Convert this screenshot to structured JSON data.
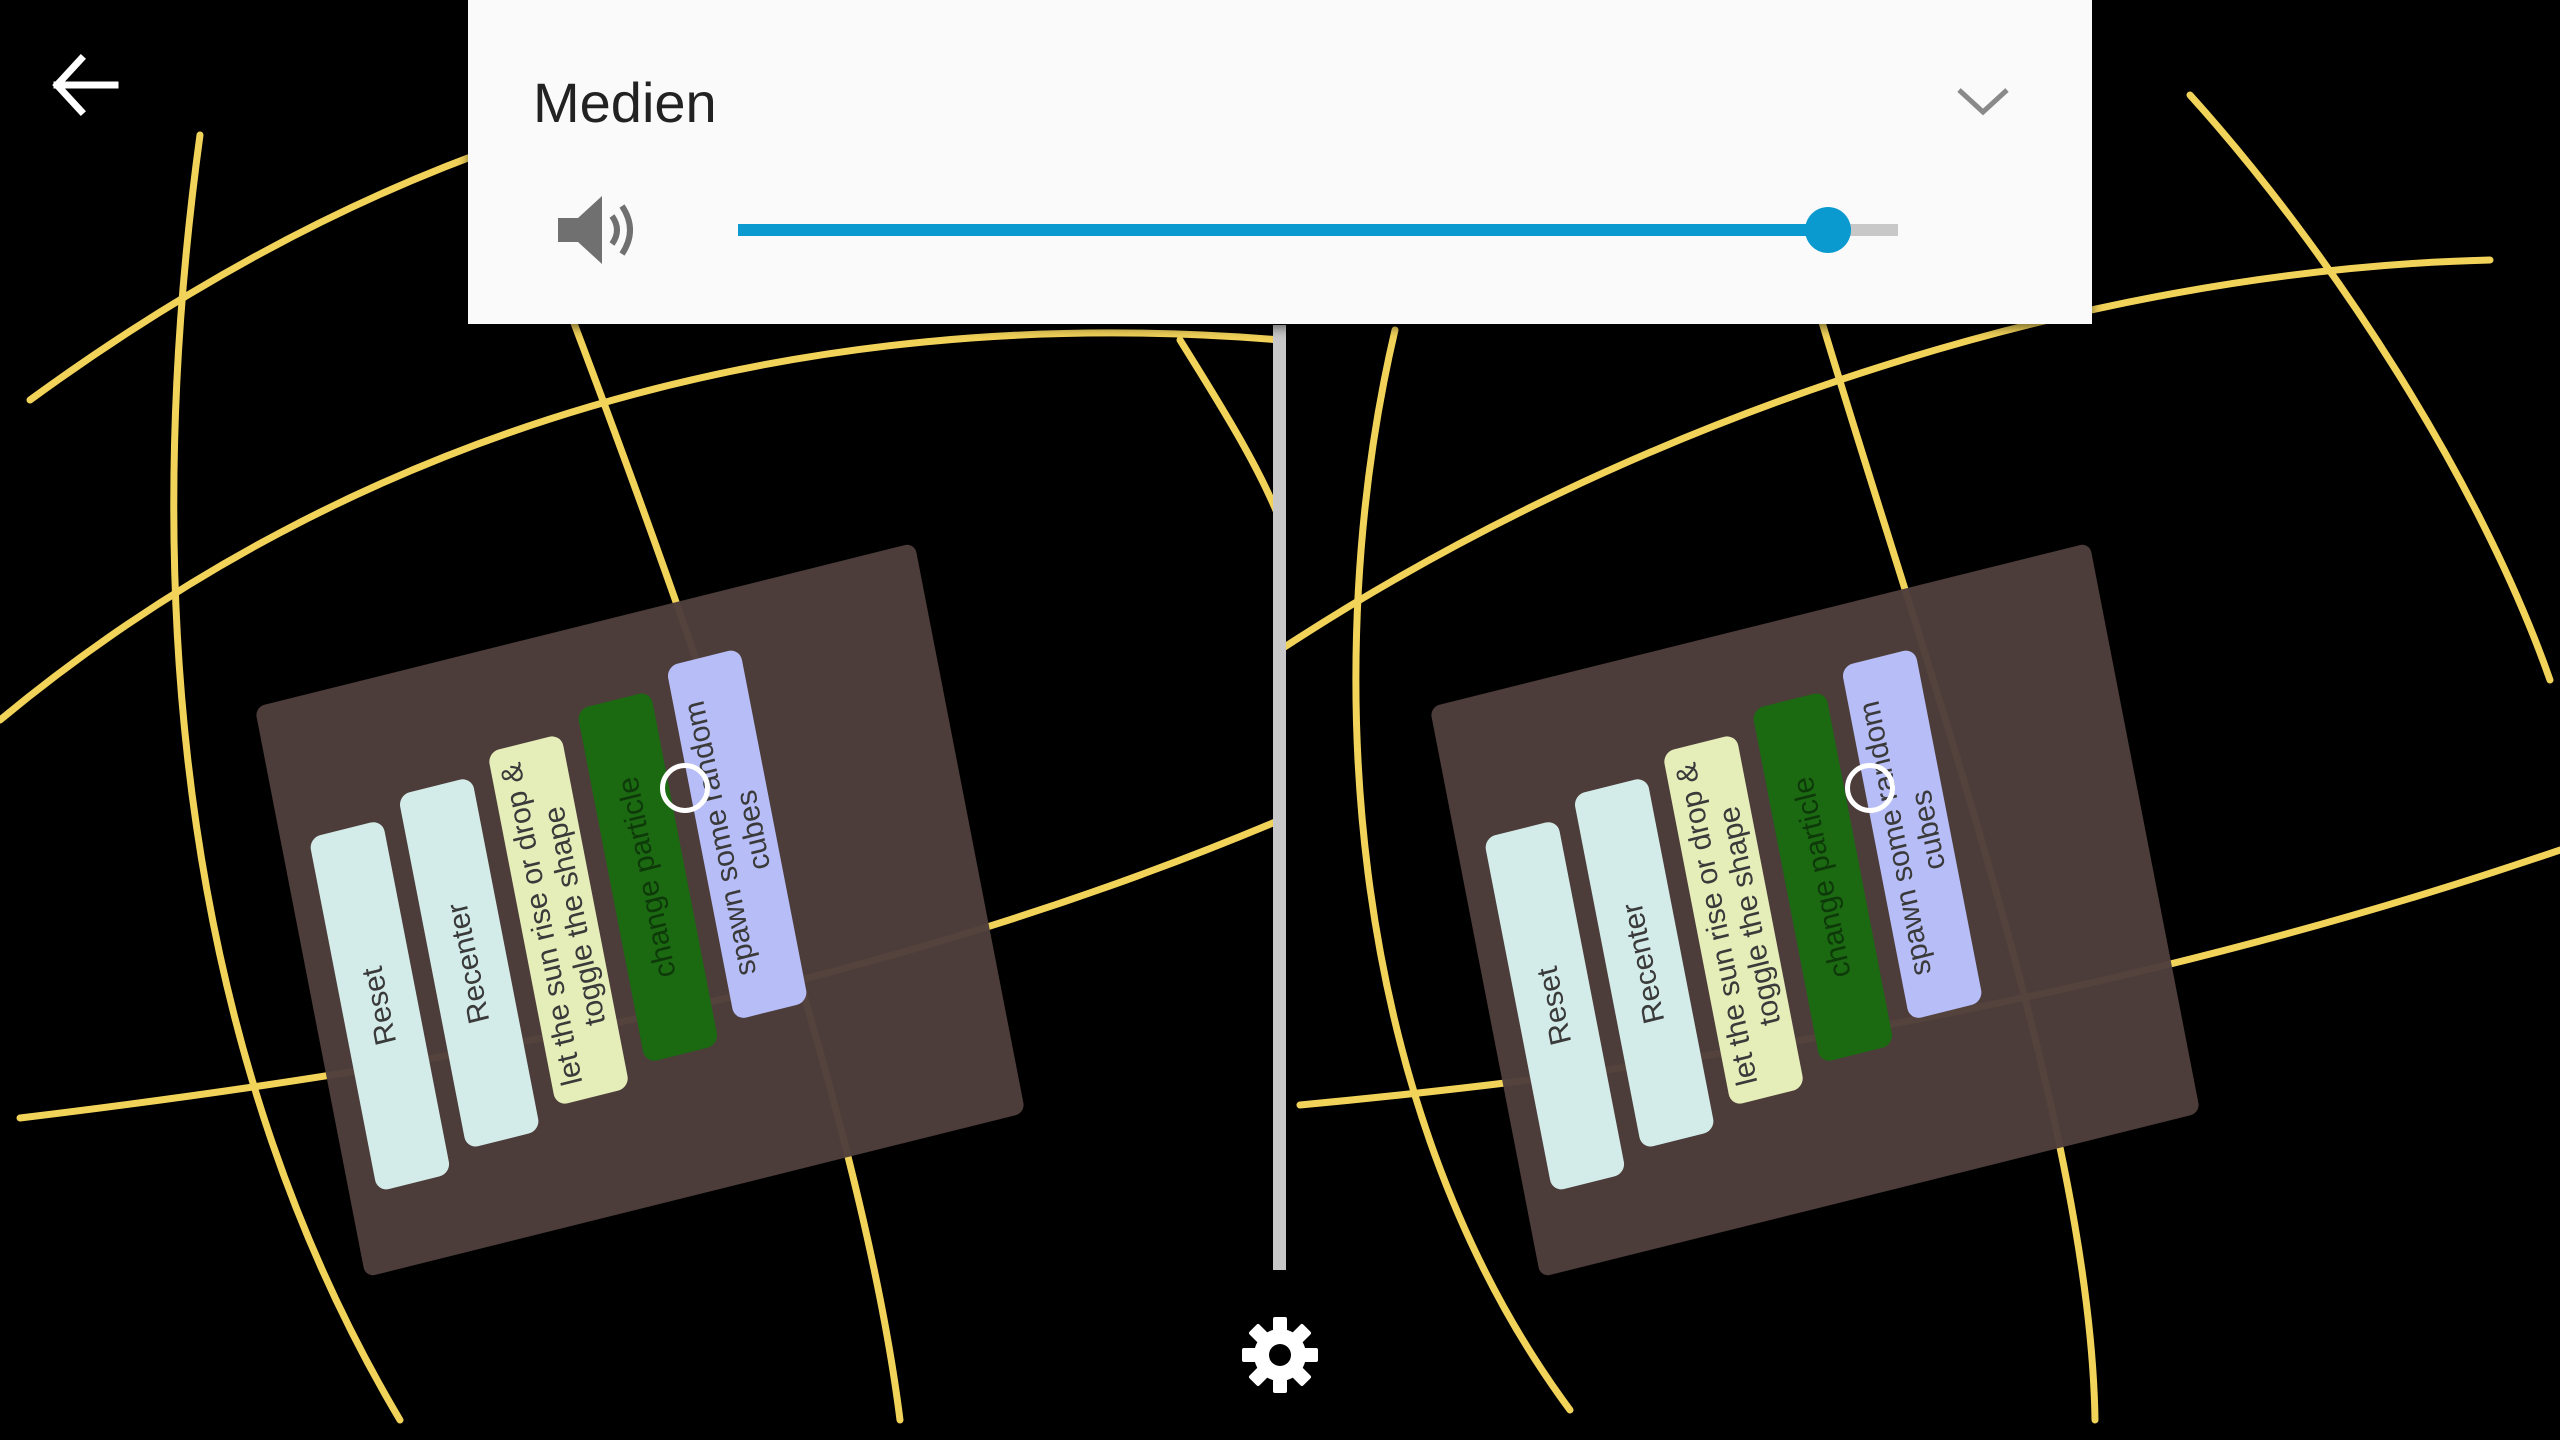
{
  "vr_menu": {
    "buttons": [
      {
        "label": "Reset"
      },
      {
        "label": "Recenter"
      },
      {
        "label": "let the sun rise or drop &\ntoggle the shape"
      },
      {
        "label": "change particle"
      },
      {
        "label": "spawn some random\ncubes"
      }
    ]
  },
  "volume_panel": {
    "title": "Medien",
    "level": 0.94
  },
  "icons": {
    "back": "arrow-left-icon",
    "settings": "gear-icon",
    "speaker": "speaker-icon",
    "expand": "chevron-down-icon"
  },
  "colors": {
    "grid_lines": "#f2d35a",
    "panel_bg": "#4e3e3c",
    "slider_accent": "#0a9ad0",
    "selected_button": "#1b6a12"
  }
}
